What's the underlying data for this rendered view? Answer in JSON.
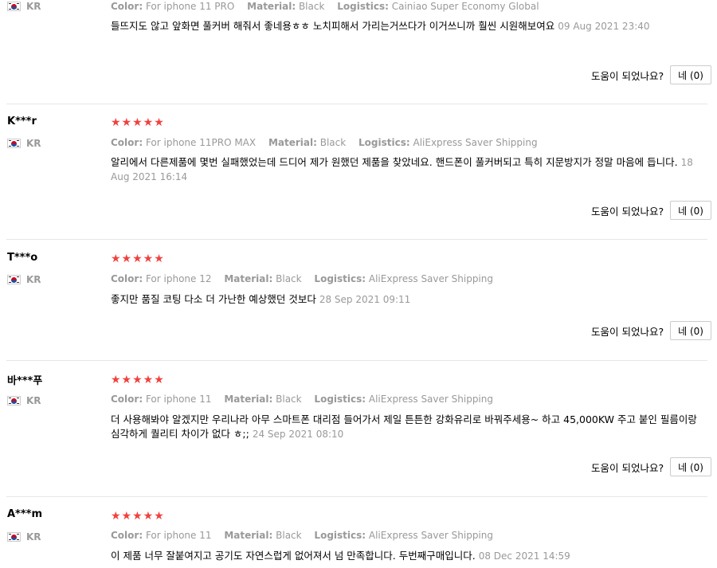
{
  "helpful_label": "도움이 되었나요?",
  "reviews": [
    {
      "user": "",
      "country": "KR",
      "stars": "★★★★★",
      "color_label": "Color:",
      "color": "For iphone 11 PRO",
      "material_label": "Material:",
      "material": "Black",
      "logistics_label": "Logistics:",
      "logistics": "Cainiao Super Economy Global",
      "text": "들뜨지도 않고 앞화면 풀커버 해줘서 좋네용ㅎㅎ 노치피해서 가리는거쓰다가 이거쓰니까 훨씬 시원해보여요",
      "date": "09 Aug 2021 23:40",
      "helpful_button": "네 (0)"
    },
    {
      "user": "K***r",
      "country": "KR",
      "stars": "★★★★★",
      "color_label": "Color:",
      "color": "For iphone 11PRO MAX",
      "material_label": "Material:",
      "material": "Black",
      "logistics_label": "Logistics:",
      "logistics": "AliExpress Saver Shipping",
      "text": "알리에서 다른제품에 몇번 실패했었는데 드디어 제가 원했던 제품을 찾았네요. 핸드폰이 풀커버되고 특히 지문방지가 정말 마음에 듭니다.",
      "date": "18 Aug 2021 16:14",
      "helpful_button": "네 (0)"
    },
    {
      "user": "T***o",
      "country": "KR",
      "stars": "★★★★★",
      "color_label": "Color:",
      "color": "For iphone 12",
      "material_label": "Material:",
      "material": "Black",
      "logistics_label": "Logistics:",
      "logistics": "AliExpress Saver Shipping",
      "text": "좋지만 품질 코팅 다소 더 가난한 예상했던 것보다",
      "date": "28 Sep 2021 09:11",
      "helpful_button": "네 (0)"
    },
    {
      "user": "바***푸",
      "country": "KR",
      "stars": "★★★★★",
      "color_label": "Color:",
      "color": "For iphone 11",
      "material_label": "Material:",
      "material": "Black",
      "logistics_label": "Logistics:",
      "logistics": "AliExpress Saver Shipping",
      "text": "더 사용해봐야 알겠지만 우리나라 아무 스마트폰 대리점 들어가서 제일 튼튼한 강화유리로 바꿔주세용~ 하고 45,000KW 주고 붙인 필름이랑 심각하게 퀄리티 차이가 없다 ㅎ;;",
      "date": "24 Sep 2021 08:10",
      "helpful_button": "네 (0)"
    },
    {
      "user": "A***m",
      "country": "KR",
      "stars": "★★★★★",
      "color_label": "Color:",
      "color": "For iphone 11",
      "material_label": "Material:",
      "material": "Black",
      "logistics_label": "Logistics:",
      "logistics": "AliExpress Saver Shipping",
      "text": "이 제품 너무 잘붙여지고 공기도 자연스럽게 없어져서 넘 만족합니다. 두번째구매입니다.",
      "date": "08 Dec 2021 14:59",
      "helpful_button": ""
    }
  ]
}
